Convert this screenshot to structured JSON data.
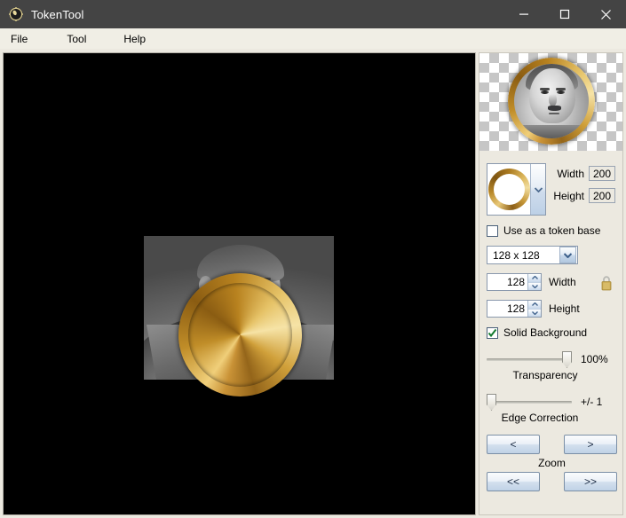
{
  "window": {
    "title": "TokenTool",
    "icon": "token-gear-icon",
    "controls": {
      "minimize": "minimize-icon",
      "maximize": "maximize-icon",
      "close": "close-icon"
    },
    "titlebar_color": "#444444",
    "panel_color": "#ece9e0"
  },
  "menubar": {
    "items": [
      {
        "label": "File"
      },
      {
        "label": "Tool"
      },
      {
        "label": "Help"
      }
    ]
  },
  "canvas": {
    "background_color": "#000000",
    "image_description": "grayscale portrait photograph",
    "overlay": "gold circular token ring"
  },
  "panel": {
    "preview": {
      "background": "transparency-checkerboard",
      "token_ring_color": "#c08d28"
    },
    "border_style": {
      "label": "border-style-combo",
      "ring_color": "#b9892a"
    },
    "dimensions": {
      "width_label": "Width",
      "width_value": "200",
      "height_label": "Height",
      "height_value": "200"
    },
    "token_base": {
      "label": "Use as a token base",
      "checked": false
    },
    "size_select": {
      "value": "128 x 128"
    },
    "spinners": {
      "width_label": "Width",
      "width_value": "128",
      "height_label": "Height",
      "height_value": "128"
    },
    "lock": {
      "icon": "padlock-icon",
      "locked": true
    },
    "solid_background": {
      "label": "Solid Background",
      "checked": true
    },
    "transparency": {
      "caption": "Transparency",
      "value": "100%",
      "percent": 100
    },
    "edge_correction": {
      "caption": "Edge Correction",
      "value": "+/- 1",
      "percent": 0
    },
    "zoom": {
      "caption": "Zoom",
      "buttons": [
        {
          "label": "<"
        },
        {
          "label": ">"
        },
        {
          "label": "<<"
        },
        {
          "label": ">>"
        }
      ]
    }
  }
}
